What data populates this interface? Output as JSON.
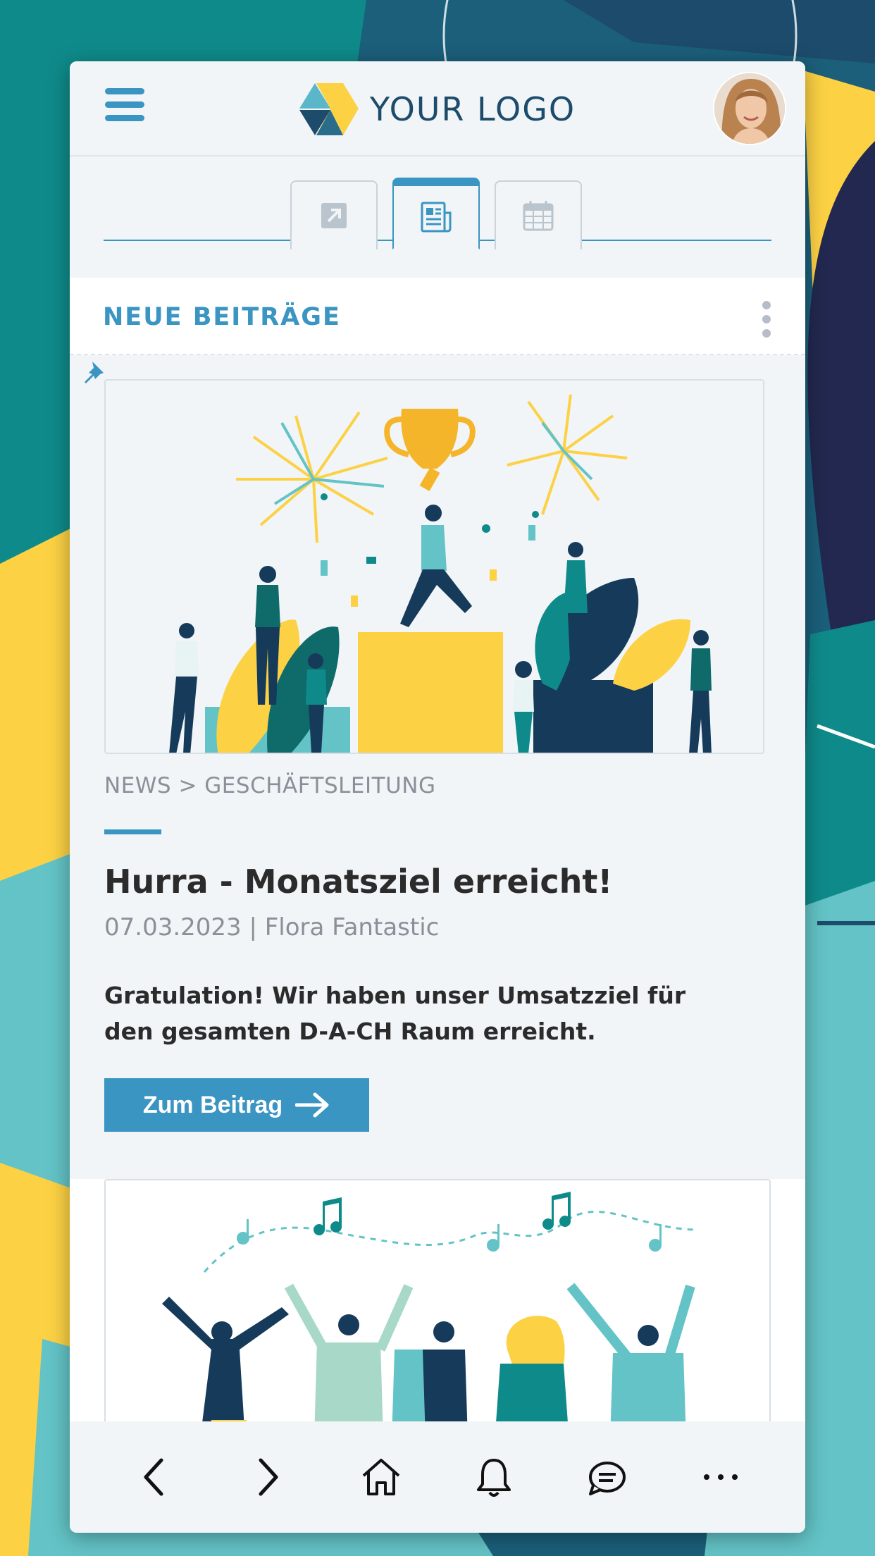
{
  "app": {
    "logo_text": "YOUR LOGO"
  },
  "tabs": [
    {
      "icon": "external-link-icon",
      "active": false
    },
    {
      "icon": "newspaper-icon",
      "active": true
    },
    {
      "icon": "calendar-icon",
      "active": false
    }
  ],
  "section": {
    "title": "NEUE BEITRÄGE"
  },
  "post": {
    "breadcrumb": "NEWS > GESCHÄFTSLEITUNG",
    "title": "Hurra - Monatsziel erreicht!",
    "meta": "07.03.2023 | Flora Fantastic",
    "body": "Gratulation! Wir haben unser Umsatzziel für den gesamten D-A-CH Raum erreicht.",
    "cta_label": "Zum Beitrag"
  },
  "bottom_nav": [
    "back-icon",
    "forward-icon",
    "home-icon",
    "bell-icon",
    "chat-icon",
    "more-icon"
  ],
  "colors": {
    "accent": "#3a95c2",
    "dark_blue": "#1d4b6b",
    "yellow": "#fcd144",
    "teal": "#0f8a8a"
  }
}
